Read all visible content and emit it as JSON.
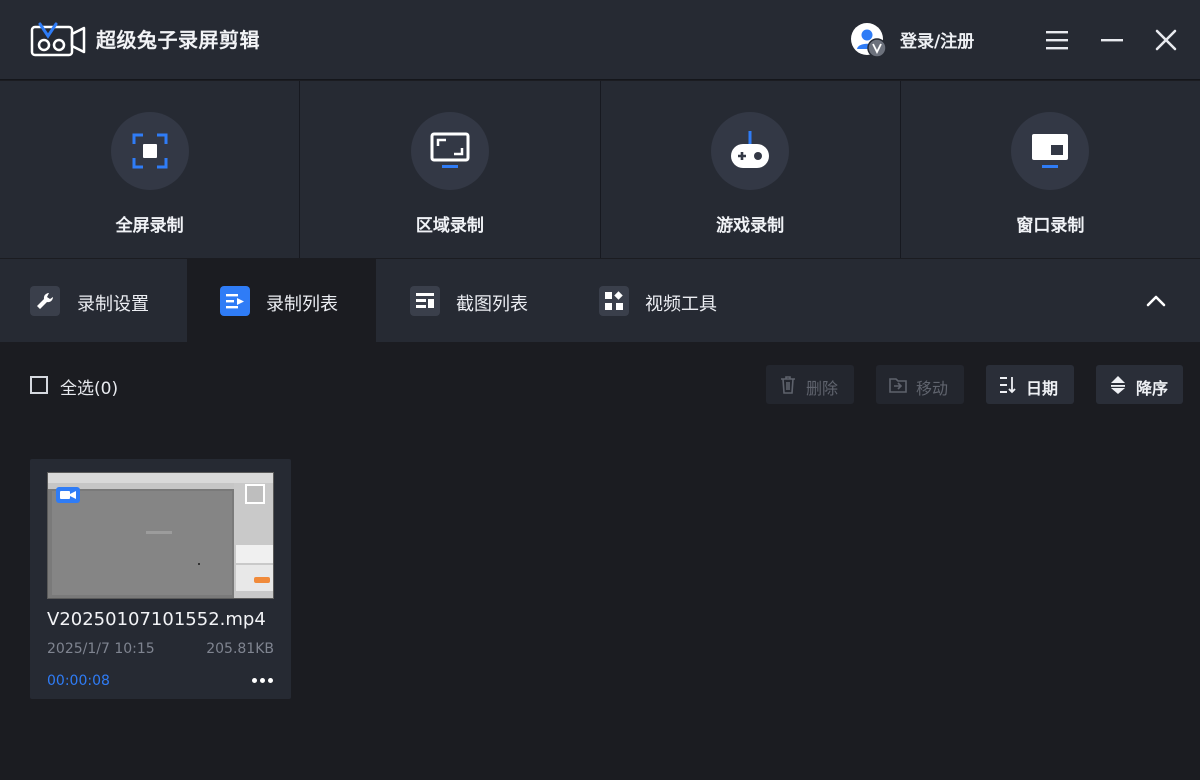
{
  "app": {
    "title": "超级兔子录屏剪辑",
    "login_label": "登录/注册"
  },
  "colors": {
    "accent": "#2f7cf6",
    "panel_bg": "#262a33",
    "page_bg": "#1b1c21"
  },
  "modes": [
    {
      "label": "全屏录制",
      "icon": "fullscreen-icon"
    },
    {
      "label": "区域录制",
      "icon": "region-icon"
    },
    {
      "label": "游戏录制",
      "icon": "gamepad-icon"
    },
    {
      "label": "窗口录制",
      "icon": "window-icon"
    }
  ],
  "tabs": [
    {
      "label": "录制设置",
      "icon": "wrench-icon",
      "active": false
    },
    {
      "label": "录制列表",
      "icon": "list-icon",
      "active": true
    },
    {
      "label": "截图列表",
      "icon": "screenshot-list-icon",
      "active": false
    },
    {
      "label": "视频工具",
      "icon": "grid-icon",
      "active": false
    }
  ],
  "toolbar": {
    "select_all": "全选(0)",
    "delete": "删除",
    "move": "移动",
    "sort_date": "日期",
    "sort_order": "降序"
  },
  "recordings": [
    {
      "filename": "V20250107101552.mp4",
      "date": "2025/1/7 10:15",
      "size": "205.81KB",
      "duration": "00:00:08"
    }
  ]
}
